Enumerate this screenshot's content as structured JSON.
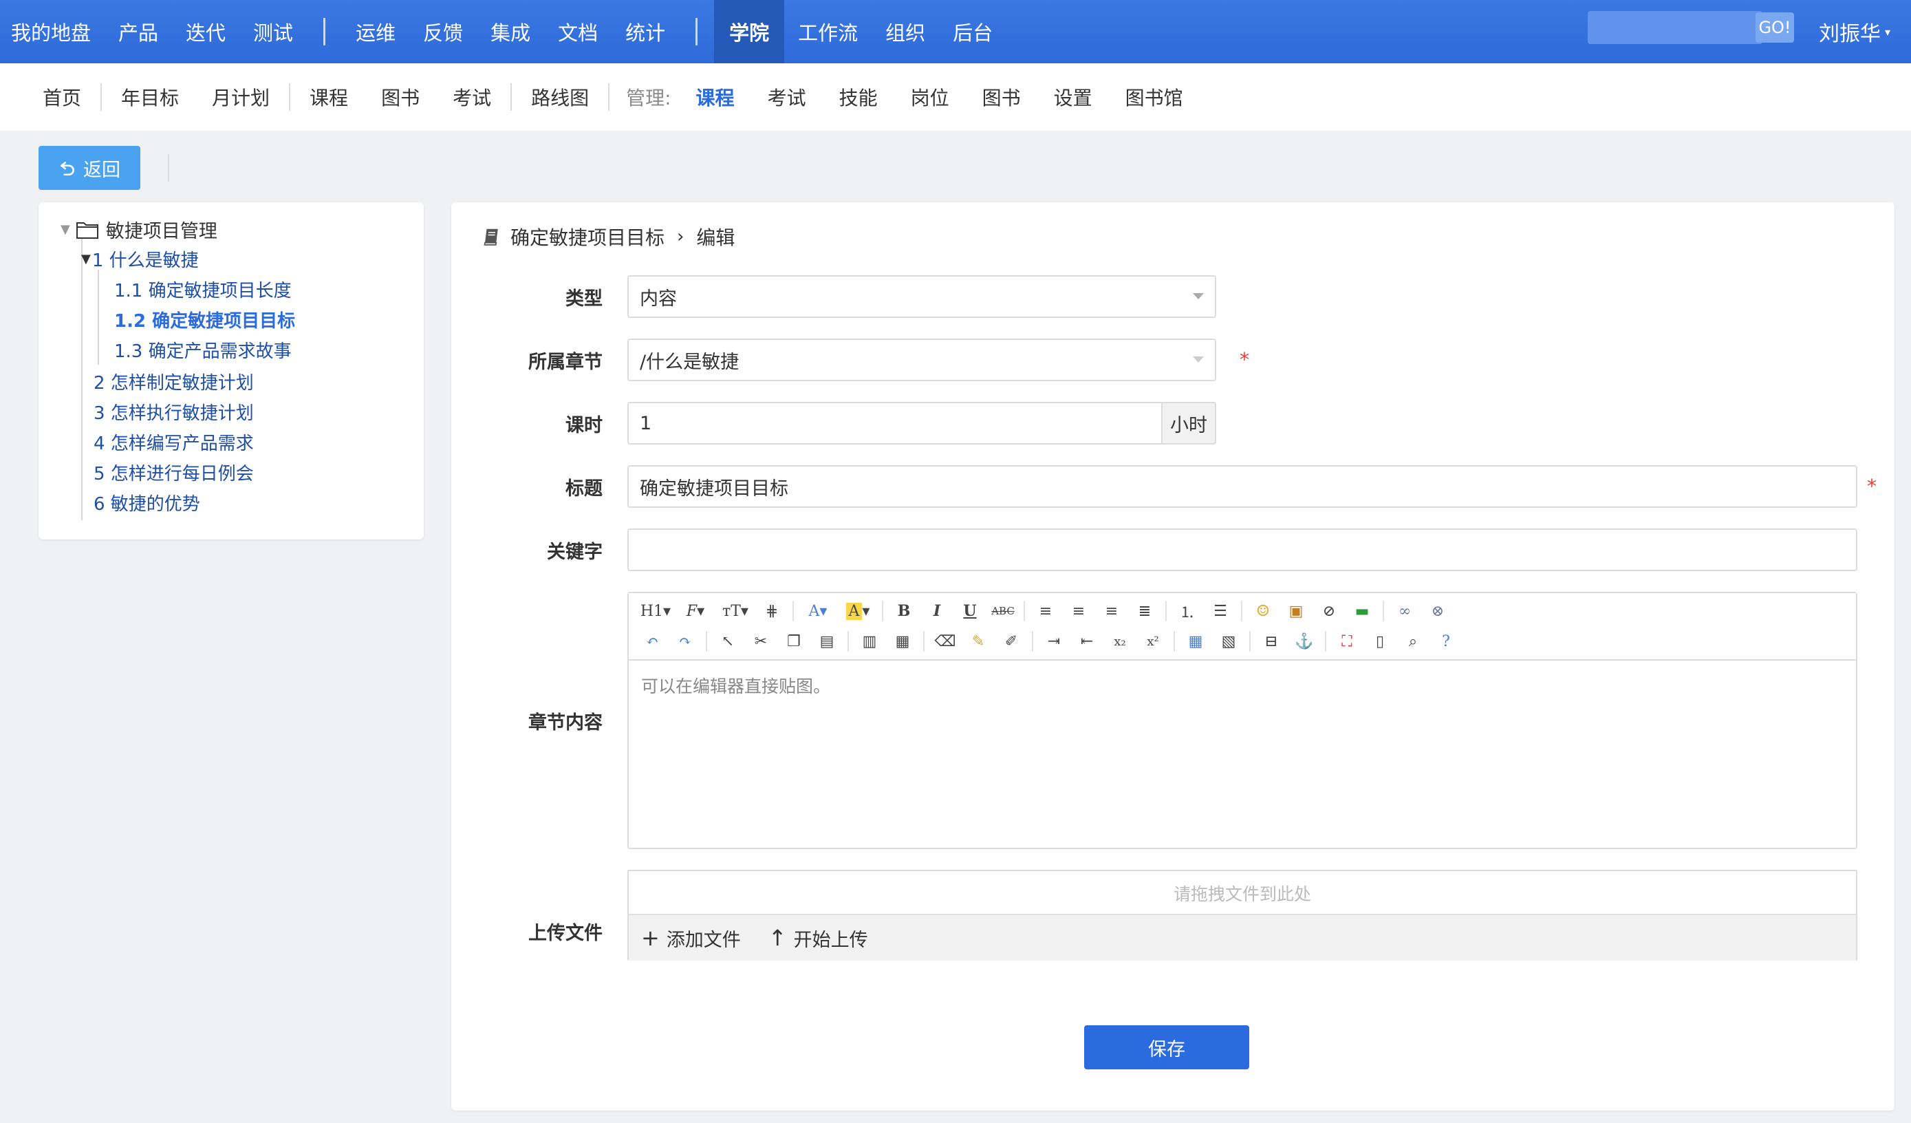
{
  "topnav": {
    "items_left": [
      "我的地盘",
      "产品",
      "迭代",
      "测试"
    ],
    "items_mid": [
      "运维",
      "反馈",
      "集成",
      "文档",
      "统计"
    ],
    "items_right": [
      "学院",
      "工作流",
      "组织",
      "后台"
    ],
    "active": "学院",
    "search_placeholder": "",
    "go_label": "GO!",
    "user_name": "刘振华"
  },
  "subnav": {
    "group1": [
      "首页"
    ],
    "group2": [
      "年目标",
      "月计划"
    ],
    "group3": [
      "课程",
      "图书",
      "考试"
    ],
    "group4": [
      "路线图"
    ],
    "manage_label": "管理:",
    "manage_items": [
      "课程",
      "考试",
      "技能",
      "岗位",
      "图书",
      "设置",
      "图书馆"
    ],
    "active": "课程"
  },
  "back_label": "返回",
  "tree": {
    "root": "敏捷项目管理",
    "chapter1": "1 什么是敏捷",
    "sub": [
      "1.1 确定敏捷项目长度",
      "1.2 确定敏捷项目目标",
      "1.3 确定产品需求故事"
    ],
    "active_sub": "1.2 确定敏捷项目目标",
    "chapters": [
      "2 怎样制定敏捷计划",
      "3 怎样执行敏捷计划",
      "4 怎样编写产品需求",
      "5 怎样进行每日例会",
      "6 敏捷的优势"
    ]
  },
  "breadcrumb": {
    "item": "确定敏捷项目目标",
    "action": "编辑"
  },
  "form": {
    "type_label": "类型",
    "type_value": "内容",
    "chapter_label": "所属章节",
    "chapter_value": "/什么是敏捷",
    "hours_label": "课时",
    "hours_value": "1",
    "hours_unit": "小时",
    "title_label": "标题",
    "title_value": "确定敏捷项目目标",
    "keywords_label": "关键字",
    "keywords_value": "",
    "content_label": "章节内容",
    "content_placeholder": "可以在编辑器直接贴图。",
    "upload_label": "上传文件",
    "upload_hint": "请拖拽文件到此处",
    "add_file": "添加文件",
    "start_upload": "开始上传",
    "required_mark": "*",
    "save_label": "保存"
  },
  "colors": {
    "primary": "#2a6be0",
    "topnav": "#2f6bd9",
    "back_button": "#4aa3f0",
    "required": "#e5413b"
  }
}
